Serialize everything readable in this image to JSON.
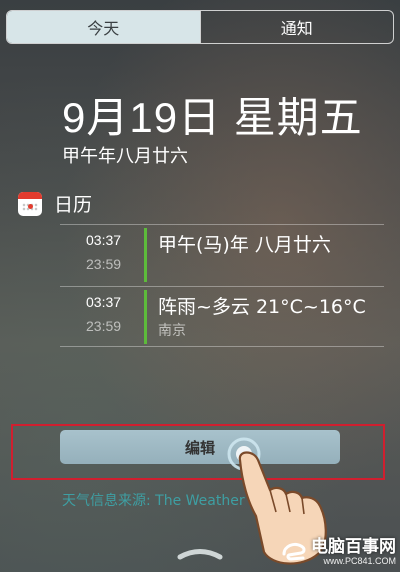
{
  "tabs": [
    {
      "label": "今天",
      "active": true
    },
    {
      "label": "通知",
      "active": false
    }
  ],
  "header": {
    "date": "9月19日 星期五",
    "lunar": "甲午年八月廿六"
  },
  "calendar": {
    "label": "日历",
    "icon": "calendar-icon",
    "events": [
      {
        "start": "03:37",
        "end": "23:59",
        "title": "甲午(马)年 八月廿六",
        "subtitle": ""
      },
      {
        "start": "03:37",
        "end": "23:59",
        "title": "阵雨~多云 21°C~16°C",
        "subtitle": "南京"
      }
    ]
  },
  "edit_button": {
    "label": "编辑"
  },
  "source_text": "天气信息来源: The Weather ... LC.",
  "watermark": {
    "text": "电脑百事网",
    "url": "www.PC841.COM"
  },
  "colors": {
    "event_bar": "#5dbb3b",
    "highlight_frame": "#d01f2f",
    "source_link": "#3e9fa3"
  }
}
